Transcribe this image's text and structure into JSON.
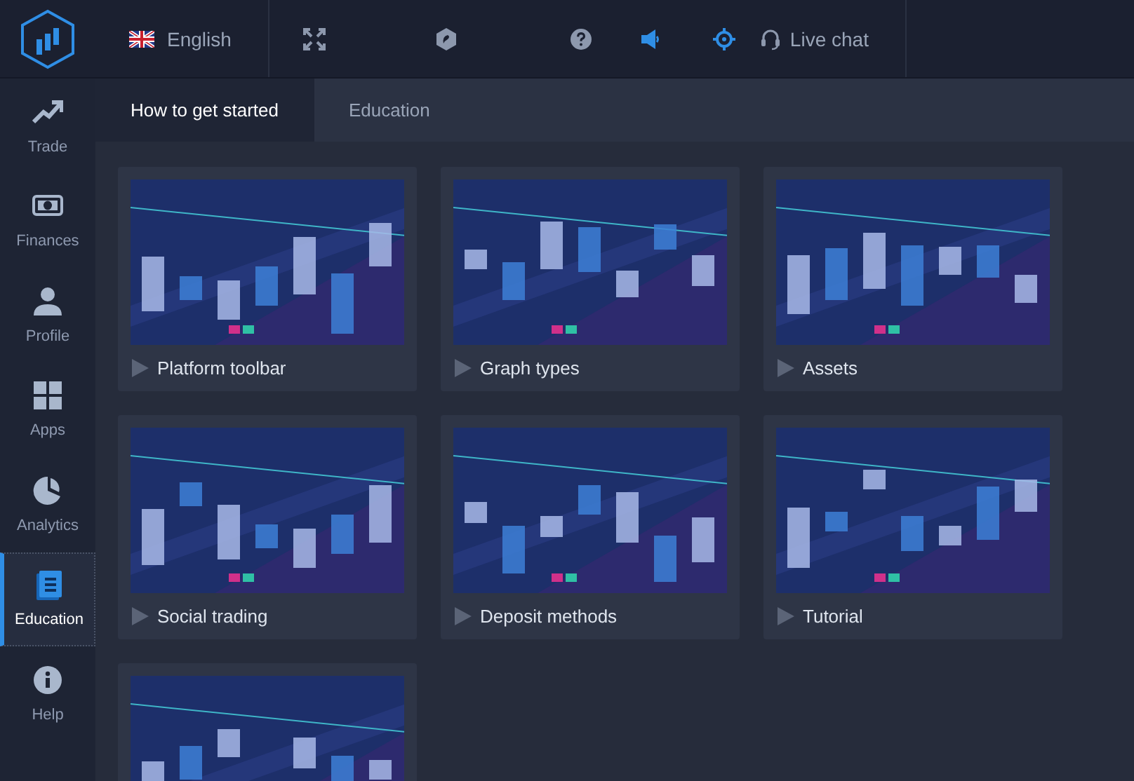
{
  "top_bar": {
    "language": "English",
    "live_chat": "Live chat"
  },
  "sidebar": {
    "items": [
      {
        "label": "Trade",
        "selected": false
      },
      {
        "label": "Finances",
        "selected": false
      },
      {
        "label": "Profile",
        "selected": false
      },
      {
        "label": "Apps",
        "selected": false
      },
      {
        "label": "Analytics",
        "selected": false
      },
      {
        "label": "Education",
        "selected": true
      },
      {
        "label": "Help",
        "selected": false
      }
    ]
  },
  "tabs": [
    {
      "label": "How to get started",
      "selected": true
    },
    {
      "label": "Education",
      "selected": false
    }
  ],
  "videos": [
    {
      "kind": "video",
      "title": "Platform toolbar"
    },
    {
      "kind": "video",
      "title": "Graph types"
    },
    {
      "kind": "video",
      "title": "Assets"
    },
    {
      "kind": "video",
      "title": "Social trading"
    },
    {
      "kind": "video",
      "title": "Deposit methods"
    },
    {
      "kind": "video",
      "title": "Tutorial"
    },
    {
      "kind": "video"
    }
  ]
}
